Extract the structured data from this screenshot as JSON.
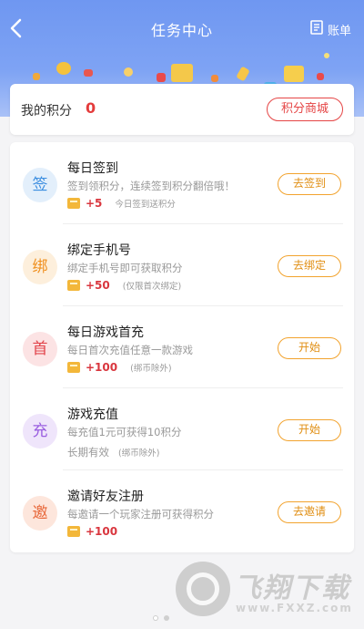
{
  "header": {
    "title": "任务中心",
    "bill_label": "账单",
    "back_icon": "chevron-left-icon",
    "bill_icon": "receipt-icon"
  },
  "points": {
    "label": "我的积分",
    "value": "0",
    "mall_button": "积分商城"
  },
  "tasks": [
    {
      "icon_char": "签",
      "icon_color": "#3a8de0",
      "icon_bg": "#e3effb",
      "name": "每日签到",
      "desc": "签到领积分，连续签到积分翻倍哦！",
      "reward": "+5",
      "note": "今日签到送积分",
      "button": "去签到"
    },
    {
      "icon_char": "绑",
      "icon_color": "#f0901f",
      "icon_bg": "#fdefdc",
      "name": "绑定手机号",
      "desc": "绑定手机号即可获取积分",
      "reward": "+50",
      "note": "(仅限首次绑定)",
      "button": "去绑定"
    },
    {
      "icon_char": "首",
      "icon_color": "#e2454c",
      "icon_bg": "#fce3e4",
      "name": "每日游戏首充",
      "desc": "每日首次充值任意一款游戏",
      "reward": "+100",
      "note": "(绑币除外)",
      "button": "开始"
    },
    {
      "icon_char": "充",
      "icon_color": "#9a5ee0",
      "icon_bg": "#efe5fb",
      "name": "游戏充值",
      "desc": "每充值1元可获得10积分",
      "note_main": "长期有效",
      "note": "(绑币除外)",
      "button": "开始"
    },
    {
      "icon_char": "邀",
      "icon_color": "#e8683a",
      "icon_bg": "#fde6dc",
      "name": "邀请好友注册",
      "desc": "每邀请一个玩家注册可获得积分",
      "reward": "+100",
      "button": "去邀请"
    }
  ],
  "watermark": {
    "text": "飞翔下载",
    "url": "www.FXXZ.com"
  },
  "colors": {
    "header_blue": "#7a9ff3",
    "accent_red": "#e43c3c",
    "button_orange": "#f2a32e"
  }
}
